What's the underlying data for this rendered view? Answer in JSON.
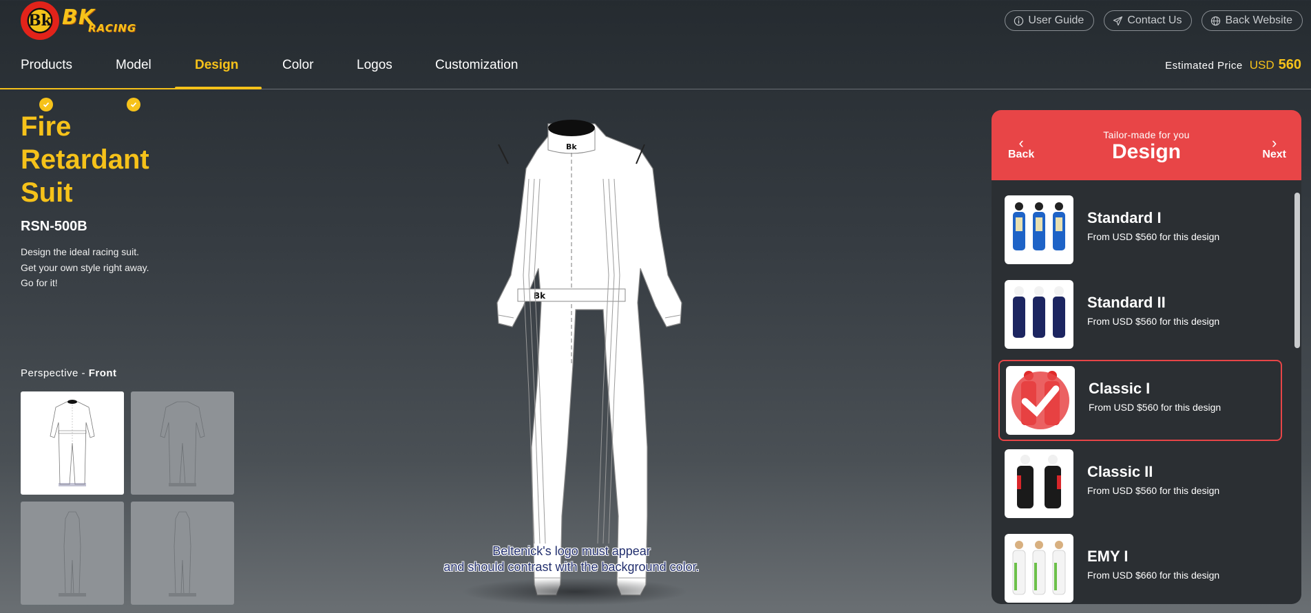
{
  "header": {
    "logo_alt": "BK Racing",
    "links": [
      {
        "label": "User Guide",
        "icon": "info-icon"
      },
      {
        "label": "Contact Us",
        "icon": "send-icon"
      },
      {
        "label": "Back Website",
        "icon": "globe-icon"
      }
    ]
  },
  "nav": {
    "tabs": [
      {
        "label": "Products",
        "state": "done"
      },
      {
        "label": "Model",
        "state": "done"
      },
      {
        "label": "Design",
        "state": "active"
      },
      {
        "label": "Color",
        "state": "pending"
      },
      {
        "label": "Logos",
        "state": "pending"
      },
      {
        "label": "Customization",
        "state": "pending"
      }
    ],
    "price_label": "Estimated Price",
    "price_currency": "USD",
    "price_value": "560"
  },
  "product": {
    "title": "Fire Retardant Suit",
    "model": "RSN-500B",
    "desc_lines": [
      "Design the ideal racing suit.",
      "Get your own style right away.",
      "Go for it!"
    ]
  },
  "perspective": {
    "label": "Perspective - ",
    "value": "Front"
  },
  "suit": {
    "notice_line1": "Beltenick's logo must appear",
    "notice_line2": "and should contrast with the background color."
  },
  "panel": {
    "subtitle": "Tailor-made for you",
    "title": "Design",
    "back_label": "Back",
    "next_label": "Next",
    "items": [
      {
        "name": "Standard I",
        "price": "From USD $560 for this design",
        "selected": false
      },
      {
        "name": "Standard II",
        "price": "From USD $560 for this design",
        "selected": false
      },
      {
        "name": "Classic I",
        "price": "From USD $560 for this design",
        "selected": true
      },
      {
        "name": "Classic II",
        "price": "From USD $560 for this design",
        "selected": false
      },
      {
        "name": "EMY I",
        "price": "From USD $660 for this design",
        "selected": false
      }
    ]
  },
  "colors": {
    "accent": "#f6c21a",
    "panel_red": "#e84547",
    "panel_bg": "#2b2f33"
  }
}
